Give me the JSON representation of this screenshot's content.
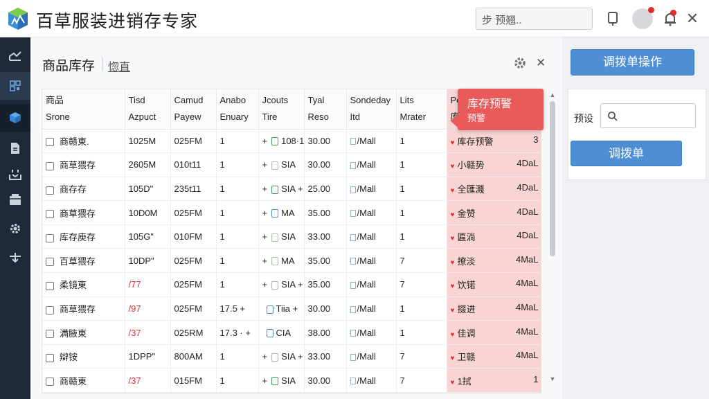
{
  "app": {
    "title": "百草服装进销存专家"
  },
  "search": {
    "value": "步 预翘.."
  },
  "sidebar": {
    "items": [
      "dashboard-icon",
      "qr-icon",
      "cube-icon",
      "document-icon",
      "inbox-icon",
      "box-icon",
      "gear-icon",
      "transfer-icon"
    ]
  },
  "main": {
    "title": "商品库存",
    "subtitle": "惚直"
  },
  "table": {
    "headers": [
      [
        "商品",
        "Srone"
      ],
      [
        "Tisd",
        "Azpuct"
      ],
      [
        "Camud",
        "Payew"
      ],
      [
        "Anabo",
        "Enuary"
      ],
      [
        "Jcouts",
        "Tire"
      ],
      [
        "Tyal",
        "Reso"
      ],
      [
        "Sondeday",
        "Itd"
      ],
      [
        "Lits",
        "Mrater"
      ],
      [
        "Poriow",
        "库存"
      ]
    ],
    "rows": [
      {
        "name": "商赣東.",
        "c1": "1025M",
        "c1_style": "green-tail",
        "c2": "025FM",
        "c3": "1",
        "c4_sign": "+",
        "c4_sq": "green",
        "c4": "108·11 +",
        "c5": "30.00",
        "c6": "/Mall",
        "c7": "1",
        "c8": "库存预警",
        "c9": "3"
      },
      {
        "name": "商草猥存",
        "c1": "2605M",
        "c1_style": "",
        "c2": "010t11",
        "c3": "1",
        "c4_sign": "+",
        "c4_sq": "grey",
        "c4": "SIA",
        "c5": "30.00",
        "c6": "/Mall",
        "c7": "1",
        "c8": "小赣势",
        "c9": "4DaL"
      },
      {
        "name": "商存存",
        "c1": "105D\"",
        "c1_style": "",
        "c2": "235t11",
        "c3": "1",
        "c4_sign": "+",
        "c4_sq": "green",
        "c4": "SIA +",
        "c5": "25.00",
        "c6": "/Mall",
        "c7": "1",
        "c8": "全匯濺",
        "c9": "4DaL"
      },
      {
        "name": "商草猥存",
        "c1": "10D0M",
        "c1_style": "",
        "c2": "025FM",
        "c3": "1",
        "c4_sign": "+",
        "c4_sq": "blue",
        "c4": "MA",
        "c5": "35.00",
        "c6": "/Mall",
        "c7": "1",
        "c8": "金赞",
        "c9": "4DaL"
      },
      {
        "name": "库存庾存",
        "c1": "105G\"",
        "c1_style": "",
        "c2": "010FM",
        "c3": "1",
        "c4_sign": "+",
        "c4_sq": "grey",
        "c4": "SIA",
        "c5": "33.00",
        "c6": "/Mall",
        "c7": "1",
        "c8": "匾淌",
        "c9": "4DaL"
      },
      {
        "name": "百草猥存",
        "c1": "10DP\"",
        "c1_style": "",
        "c2": "025FM",
        "c3": "1",
        "c4_sign": "+",
        "c4_sq": "grey",
        "c4": "MA",
        "c5": "35.00",
        "c6": "/Mall",
        "c7": "7",
        "c8": "撩淡",
        "c9": "4MaL"
      },
      {
        "name": "柔镜東",
        "c1": "/77",
        "c1_style": "red",
        "c2": "025FM",
        "c3": "1",
        "c4_sign": "+",
        "c4_sq": "grey",
        "c4": "SIA +",
        "c5": "35.00",
        "c6": "/Mall",
        "c7": "7",
        "c8": "饮锘",
        "c9": "4MaL"
      },
      {
        "name": "商草猥存",
        "c1": "/97",
        "c1_style": "red",
        "c2": "025FM",
        "c3": "17.5 +",
        "c4_sign": "",
        "c4_sq": "blue",
        "c4": "Tiia +",
        "c5": "30.00",
        "c6": "/Mall",
        "c7": "1",
        "c8": "掇进",
        "c9": "4MaL"
      },
      {
        "name": "满腋東",
        "c1": "/37",
        "c1_style": "red",
        "c2": "025RM",
        "c3": "17.3 · +",
        "c4_sign": "",
        "c4_sq": "blue",
        "c4": "CIA",
        "c5": "38.00",
        "c6": "/Mall",
        "c7": "1",
        "c8": "佳调",
        "c9": "4MaL"
      },
      {
        "name": "辯铵",
        "c1": "1DPP\"",
        "c1_style": "",
        "c2": "800AM",
        "c3": "1",
        "c4_sign": "+",
        "c4_sq": "grey",
        "c4": "SIA +",
        "c5": "33.00",
        "c6": "/Mall",
        "c7": "7",
        "c8": "卫赣",
        "c9": "4MaL"
      },
      {
        "name": "商赣東",
        "c1": "/37",
        "c1_style": "red",
        "c2": "015FM",
        "c3": "1",
        "c4_sign": "+",
        "c4_sq": "green",
        "c4": "SIA",
        "c5": "30.00",
        "c6": "/Mall",
        "c7": "7",
        "c8": "1拭",
        "c9": "1"
      }
    ]
  },
  "warning_popup": {
    "title": "库存预警",
    "subtitle": "预警"
  },
  "right_panel": {
    "transfer_op_label": "调拨单操作",
    "filter_label": "预设",
    "transfer_label": "调拨单"
  },
  "colors": {
    "accent": "#4e8ed3",
    "warning": "#e95a5a",
    "warning_bg": "#f8d4d4",
    "sidebar": "#1f2a38"
  }
}
